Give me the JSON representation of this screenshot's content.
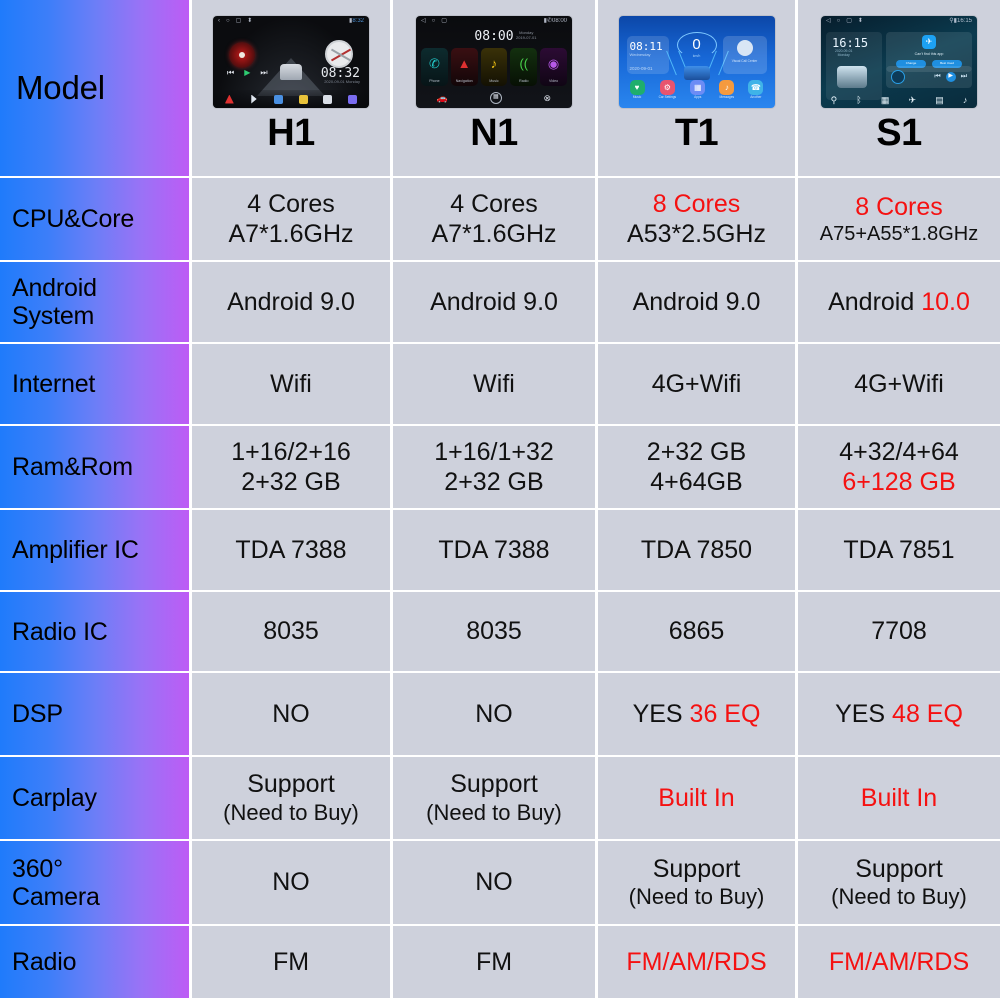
{
  "table": {
    "accent_red": "#f51111",
    "cell_bg": "#ced1dc",
    "label_gradient_from": "#1f7bfb",
    "label_gradient_to": "#bd5cf5",
    "columns": [
      "Model",
      "H1",
      "N1",
      "T1",
      "S1"
    ],
    "rows": [
      {
        "label": "Model",
        "type": "header",
        "cells": [
          {
            "model": "H1",
            "device": "h1-head-unit"
          },
          {
            "model": "N1",
            "device": "n1-head-unit"
          },
          {
            "model": "T1",
            "device": "t1-head-unit"
          },
          {
            "model": "S1",
            "device": "s1-head-unit"
          }
        ]
      },
      {
        "label": "CPU&Core",
        "size": "normal",
        "cells": [
          {
            "lines": [
              {
                "t": "4 Cores",
                "c": "black"
              },
              {
                "t": "A7*1.6GHz",
                "c": "black"
              }
            ]
          },
          {
            "lines": [
              {
                "t": "4 Cores",
                "c": "black"
              },
              {
                "t": "A7*1.6GHz",
                "c": "black"
              }
            ]
          },
          {
            "lines": [
              {
                "t": "8 Cores",
                "c": "red"
              },
              {
                "t": "A53*2.5GHz",
                "c": "black"
              }
            ]
          },
          {
            "lines": [
              {
                "t": "8 Cores",
                "c": "red"
              },
              {
                "t": "A75+A55*1.8GHz",
                "c": "black",
                "size": "xsmall"
              }
            ]
          }
        ]
      },
      {
        "label": "Android\nSystem",
        "cells": [
          {
            "lines": [
              {
                "t": "Android 9.0",
                "c": "black"
              }
            ]
          },
          {
            "lines": [
              {
                "t": "Android 9.0",
                "c": "black"
              }
            ]
          },
          {
            "lines": [
              {
                "t": "Android 9.0",
                "c": "black"
              }
            ]
          },
          {
            "lines": [
              {
                "t": "Android ",
                "c": "black",
                "tail": "10.0",
                "tail_c": "red"
              }
            ]
          }
        ]
      },
      {
        "label": "Internet",
        "cells": [
          {
            "lines": [
              {
                "t": "Wifi",
                "c": "black"
              }
            ]
          },
          {
            "lines": [
              {
                "t": "Wifi",
                "c": "black"
              }
            ]
          },
          {
            "lines": [
              {
                "t": "4G+Wifi",
                "c": "black"
              }
            ]
          },
          {
            "lines": [
              {
                "t": "4G+Wifi",
                "c": "black"
              }
            ]
          }
        ]
      },
      {
        "label": "Ram&Rom",
        "cells": [
          {
            "lines": [
              {
                "t": "1+16/2+16",
                "c": "black"
              },
              {
                "t": "2+32 GB",
                "c": "black"
              }
            ]
          },
          {
            "lines": [
              {
                "t": "1+16/1+32",
                "c": "black"
              },
              {
                "t": "2+32 GB",
                "c": "black"
              }
            ]
          },
          {
            "lines": [
              {
                "t": "2+32 GB",
                "c": "black"
              },
              {
                "t": "4+64GB",
                "c": "black"
              }
            ]
          },
          {
            "lines": [
              {
                "t": "4+32/4+64",
                "c": "black"
              },
              {
                "t": "6+128 GB",
                "c": "red"
              }
            ]
          }
        ]
      },
      {
        "label": "Amplifier IC",
        "cells": [
          {
            "lines": [
              {
                "t": "TDA 7388",
                "c": "black"
              }
            ]
          },
          {
            "lines": [
              {
                "t": "TDA 7388",
                "c": "black"
              }
            ]
          },
          {
            "lines": [
              {
                "t": "TDA 7850",
                "c": "black"
              }
            ]
          },
          {
            "lines": [
              {
                "t": "TDA 7851",
                "c": "black"
              }
            ]
          }
        ]
      },
      {
        "label": "Radio IC",
        "cells": [
          {
            "lines": [
              {
                "t": "8035",
                "c": "black"
              }
            ]
          },
          {
            "lines": [
              {
                "t": "8035",
                "c": "black"
              }
            ]
          },
          {
            "lines": [
              {
                "t": "6865",
                "c": "black"
              }
            ]
          },
          {
            "lines": [
              {
                "t": "7708",
                "c": "black"
              }
            ]
          }
        ]
      },
      {
        "label": "DSP",
        "cells": [
          {
            "lines": [
              {
                "t": "NO",
                "c": "black"
              }
            ]
          },
          {
            "lines": [
              {
                "t": "NO",
                "c": "black"
              }
            ]
          },
          {
            "lines": [
              {
                "t": "YES ",
                "c": "black",
                "tail": "36 EQ",
                "tail_c": "red"
              }
            ]
          },
          {
            "lines": [
              {
                "t": "YES ",
                "c": "black",
                "tail": "48 EQ",
                "tail_c": "red"
              }
            ]
          }
        ]
      },
      {
        "label": "Carplay",
        "cells": [
          {
            "lines": [
              {
                "t": "Support",
                "c": "black"
              },
              {
                "t": "(Need to Buy)",
                "c": "black",
                "size": "small"
              }
            ]
          },
          {
            "lines": [
              {
                "t": "Support",
                "c": "black"
              },
              {
                "t": "(Need to Buy)",
                "c": "black",
                "size": "small"
              }
            ]
          },
          {
            "lines": [
              {
                "t": "Built In",
                "c": "red"
              }
            ]
          },
          {
            "lines": [
              {
                "t": "Built In",
                "c": "red"
              }
            ]
          }
        ]
      },
      {
        "label": "360°\nCamera",
        "cells": [
          {
            "lines": [
              {
                "t": "NO",
                "c": "black"
              }
            ]
          },
          {
            "lines": [
              {
                "t": "NO",
                "c": "black"
              }
            ]
          },
          {
            "lines": [
              {
                "t": "Support",
                "c": "black"
              },
              {
                "t": "(Need to Buy)",
                "c": "black",
                "size": "small"
              }
            ]
          },
          {
            "lines": [
              {
                "t": "Support",
                "c": "black"
              },
              {
                "t": "(Need to Buy)",
                "c": "black",
                "size": "small"
              }
            ]
          }
        ]
      },
      {
        "label": "Radio",
        "cells": [
          {
            "lines": [
              {
                "t": "FM",
                "c": "black"
              }
            ]
          },
          {
            "lines": [
              {
                "t": "FM",
                "c": "black"
              }
            ]
          },
          {
            "lines": [
              {
                "t": "FM/AM/RDS",
                "c": "red"
              }
            ]
          },
          {
            "lines": [
              {
                "t": "FM/AM/RDS",
                "c": "red"
              }
            ]
          }
        ]
      },
      {
        "label": "",
        "partial": true,
        "cells": [
          {
            "lines": []
          },
          {
            "lines": []
          },
          {
            "lines": []
          },
          {
            "lines": []
          }
        ]
      }
    ]
  },
  "devices": {
    "h1": {
      "status_time": "8:32",
      "clock": "08:32",
      "clock_sub": "2020-09-01   Monday",
      "dock": [
        "GPS Navigation",
        "Bluetooth",
        "Apps",
        "Phone",
        "Radio",
        "Music"
      ]
    },
    "n1": {
      "clock": "08:00",
      "clock_sub": "Monday\n2019-07-01",
      "status_time": "08:00",
      "tiles": [
        {
          "name": "Phone",
          "glyph": "✆"
        },
        {
          "name": "Navigation",
          "glyph": "▲"
        },
        {
          "name": "Music",
          "glyph": "♪"
        },
        {
          "name": "Radio",
          "glyph": "(("
        },
        {
          "name": "Video",
          "glyph": "◉"
        }
      ]
    },
    "t1": {
      "time": "08:11",
      "day": "Wednesday",
      "date": "2020-09-01",
      "speed": "0",
      "speed_unit": "km/h",
      "avatar_caption": "Visual Call Center",
      "icons": [
        {
          "name": "Music",
          "glyph": "♥"
        },
        {
          "name": "Car Settings",
          "glyph": "⚙"
        },
        {
          "name": "Apps",
          "glyph": "▦"
        },
        {
          "name": "Messages",
          "glyph": "♪"
        },
        {
          "name": "Another",
          "glyph": "☎"
        }
      ]
    },
    "s1": {
      "time": "16:15",
      "sub": "2020-09-01\nMonday",
      "status_time": "16:15",
      "app_message": "Can't find this app",
      "buttons": [
        "Change",
        "Best Used"
      ],
      "dock": [
        "Navi",
        "Bluetooth",
        "Apps",
        "Radio",
        "Video",
        "Music"
      ]
    }
  }
}
